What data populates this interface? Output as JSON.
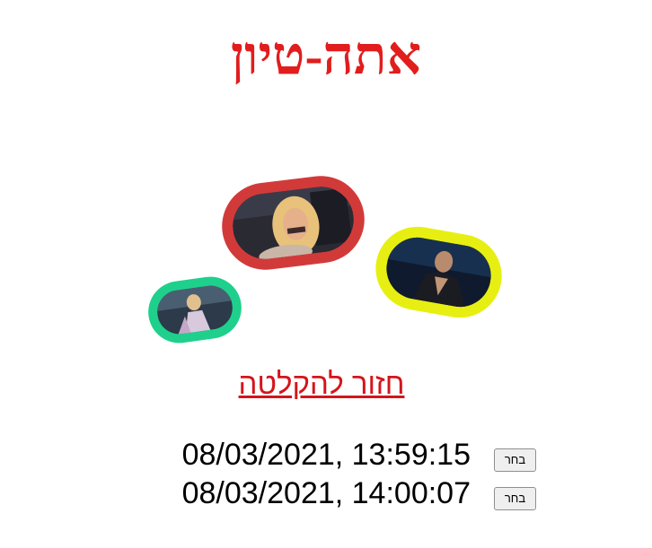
{
  "header": {
    "title": "אתה-טיון"
  },
  "images": [
    {
      "name": "performer-photo-1",
      "ring_color": "#d23a3a"
    },
    {
      "name": "performer-photo-2",
      "ring_color": "#e7ef12"
    },
    {
      "name": "performer-photo-3",
      "ring_color": "#1fd08c"
    }
  ],
  "links": {
    "back_to_recording": "חזור להקלטה"
  },
  "recordings": [
    {
      "timestamp": "08/03/2021, 13:59:15",
      "button_label": "בחר"
    },
    {
      "timestamp": "08/03/2021, 14:00:07",
      "button_label": "בחר"
    }
  ],
  "colors": {
    "title": "#e11d1d",
    "link": "#d4151b"
  }
}
